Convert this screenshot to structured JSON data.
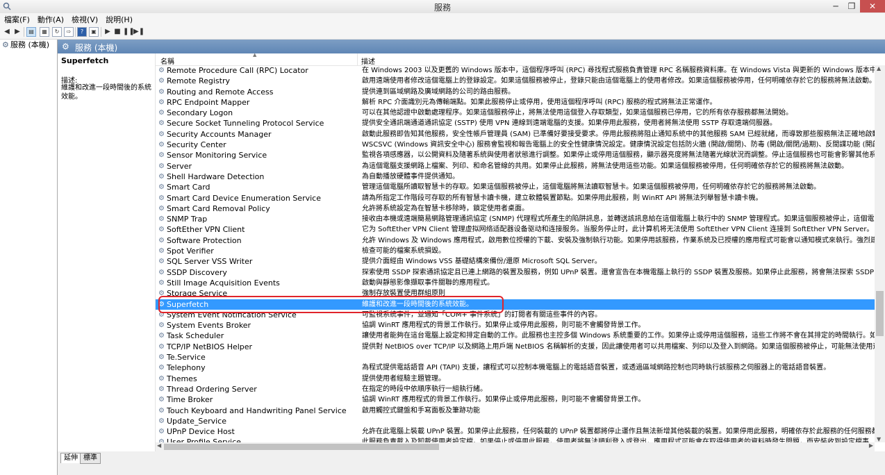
{
  "window": {
    "title": "服務"
  },
  "menu": [
    "檔案(F)",
    "動作(A)",
    "檢視(V)",
    "說明(H)"
  ],
  "tree": {
    "root": "服務 (本機)"
  },
  "main_header": "服務 (本機)",
  "details": {
    "service": "Superfetch",
    "label": "描述:",
    "text": "維護和改進一段時間後的系統效能。"
  },
  "columns": {
    "name": "名稱",
    "desc": "描述"
  },
  "rows": [
    {
      "name": "Remote Procedure Call (RPC) Locator",
      "desc": "在 Windows 2003 以及更舊的 Windows 版本中，這個程序呼叫 (RPC) 尋找程式服務負責管理 RPC 名稱服務資料庫。在 Windows Vista 與更新的 Windows 版本中，此"
    },
    {
      "name": "Remote Registry",
      "desc": "啟用遠端使用者修改這個電腦上的登錄設定。如果這個服務被停止，登錄只能由這個電腦上的使用者修改。如果這個服務被停用，任何明確依存於它的服務將無法啟動。"
    },
    {
      "name": "Routing and Remote Access",
      "desc": "提供連到區域網路及廣域網路的公司的路由服務。"
    },
    {
      "name": "RPC Endpoint Mapper",
      "desc": "解析 RPC 介面識別元為傳輸端點。如果此服務停止或停用，使用這個程序呼叫 (RPC) 服務的程式將無法正常運作。"
    },
    {
      "name": "Secondary Logon",
      "desc": "可以在其他認證中啟動處理程序。如果這個服務停止，將無法使用這個登入存取類型，如果這個服務已停用，它的所有依存服務都無法開始。"
    },
    {
      "name": "Secure Socket Tunneling Protocol Service",
      "desc": "提供安全通訊端通道通訊協定 (SSTP) 使用 VPN 連線到遠端電腦的支援。如果停用此服務，使用者將無法使用 SSTP 存取遠端伺服器。"
    },
    {
      "name": "Security Accounts Manager",
      "desc": "啟動此服務即告知其他服務，安全性帳戶管理員 (SAM) 已準備好要接受要求。停用此服務將阻止通知系統中的其他服務 SAM 已經就緒，而導致那些服務無法正確地啟動"
    },
    {
      "name": "Security Center",
      "desc": "WSCSVC (Windows 資訊安全中心) 服務會監視和報告電腦上的安全性健康情況設定。健康情況設定包括防火牆 (開啟/關閉)、防毒 (開啟/關閉/過期)、反間諜功能 (開啟/"
    },
    {
      "name": "Sensor Monitoring Service",
      "desc": "監視各項感應器，以公開資料及隨著系統與使用者狀態進行調整。如果停止或停用這個服務，顯示器亮度將無法隨著光線狀況而調整。停止這個服務也可能會影響其他系"
    },
    {
      "name": "Server",
      "desc": "為這個電腦支援網路上檔案、列印、和命名管線的共用。如果停止此服務，將無法使用這些功能。如果這個服務被停用，任何明確依存於它的服務將無法啟動。"
    },
    {
      "name": "Shell Hardware Detection",
      "desc": "為自動播放硬體事件提供通知。"
    },
    {
      "name": "Smart Card",
      "desc": "管理這個電腦所讀取智慧卡的存取。如果這個服務被停止，這個電腦將無法讀取智慧卡。如果這個服務被停用，任何明確依存於它的服務將無法啟動。"
    },
    {
      "name": "Smart Card Device Enumeration Service",
      "desc": "請為所指定工作階段可存取的所有智慧卡讀卡機，建立軟體裝置節點。如果停用此服務，則 WinRT API 將無法列舉智慧卡讀卡機。"
    },
    {
      "name": "Smart Card Removal Policy",
      "desc": "允許將系統設定為在智慧卡移除時，鎖定使用者桌面。"
    },
    {
      "name": "SNMP Trap",
      "desc": "接收由本機或遠端簡易網路管理通訊協定 (SNMP) 代理程式所產生的陷阱訊息，並轉送該訊息給在這個電腦上執行中的 SNMP 管理程式。如果這個服務被停止，這個電腦"
    },
    {
      "name": "SoftEther VPN Client",
      "desc": "它为 SoftEther VPN Client 管理虚拟网络适配器设备驱动和连接服务。当服务停止时，此计算机将无法使用 SoftEther VPN Client 连接到 SoftEther VPN Server。"
    },
    {
      "name": "Software Protection",
      "desc": "允許 Windows 及 Windows 應用程式，啟用數位授權的下載、安裝及強制執行功能。如果停用該服務，作業系統及已授權的應用程式可能會以通知模式來執行。強烈建"
    },
    {
      "name": "Spot Verifier",
      "desc": "檢查可能的檔案系統損毀。"
    },
    {
      "name": "SQL Server VSS Writer",
      "desc": "提供介面經由 Windows VSS 基礎結構來備份/還原 Microsoft SQL Server。"
    },
    {
      "name": "SSDP Discovery",
      "desc": "探索使用 SSDP 探索通訊協定且已連上網路的裝置及服務，例如 UPnP 裝置。還會宣告在本機電腦上執行的 SSDP 裝置及服務。如果停止此服務，將會無法探索 SSDP 型"
    },
    {
      "name": "Still Image Acquisition Events",
      "desc": "啟動與靜態影像擷取事件關聯的應用程式。"
    },
    {
      "name": "Storage Service",
      "desc": "強制存放裝置使用群組原則"
    },
    {
      "name": "Superfetch",
      "desc": "維護和改進一段時間後的系統效能。"
    },
    {
      "name": "System Event Notification Service",
      "desc": "可監視系統事件，並通知「COM+ 事件系統」的訂閱者有關這些事件的內容。"
    },
    {
      "name": "System Events Broker",
      "desc": "協調 WinRT 應用程式的背景工作執行。如果停止或停用此服務，則可能不會觸發背景工作。"
    },
    {
      "name": "Task Scheduler",
      "desc": "讓使用者能夠在這台電腦上設定和排定自動的工作。此服務也主控多個 Windows 系統重要的工作。如果停止或停用這個服務，這些工作將不會在其排定的時間執行。如"
    },
    {
      "name": "TCP/IP NetBIOS Helper",
      "desc": "提供對 NetBIOS over TCP/IP 以及網路上用戶端 NetBIOS 名稱解析的支援，因此讓使用者可以共用檔案、列印以及登入到網路。如果這個服務被停止，可能無法使用這"
    },
    {
      "name": "Te.Service",
      "desc": ""
    },
    {
      "name": "Telephony",
      "desc": "為程式提供電話語音 API (TAPI) 支援，讓程式可以控制本機電腦上的電話語音裝置，或透過區域網路控制也同時執行該服務之伺服器上的電話語音裝置。"
    },
    {
      "name": "Themes",
      "desc": "提供使用者經驗主題管理。"
    },
    {
      "name": "Thread Ordering Server",
      "desc": "在指定的時段中依順序執行一組執行緒。"
    },
    {
      "name": "Time Broker",
      "desc": "協調 WinRT 應用程式的背景工作執行。如果停止或停用此服務，則可能不會觸發背景工作。"
    },
    {
      "name": "Touch Keyboard and Handwriting Panel Service",
      "desc": "啟用觸控式鍵盤和手寫面板及筆跡功能"
    },
    {
      "name": "Update_Service",
      "desc": ""
    },
    {
      "name": "UPnP Device Host",
      "desc": "允許在此電腦上裝載 UPnP 裝置。如果停止此服務，任何裝載的 UPnP 裝置都將停止運作且無法新增其他裝載的裝置。如果停用此服務，明確依存於此服務的任何服務都"
    },
    {
      "name": "User Profile Service",
      "desc": "此服務負責載入及卸載使用者設定檔。如果停止或停用此服務，使用者將無法順利登入或登出，應用程式可能會在取得使用者的資料時發生問題，而安裝收到設定檔事"
    }
  ],
  "selected_index": 22,
  "tabs": [
    "延伸",
    "標準"
  ],
  "colors": {
    "selection": "#3399ff",
    "highlight_outline": "#e0242a",
    "header": "#6a8fbd"
  }
}
